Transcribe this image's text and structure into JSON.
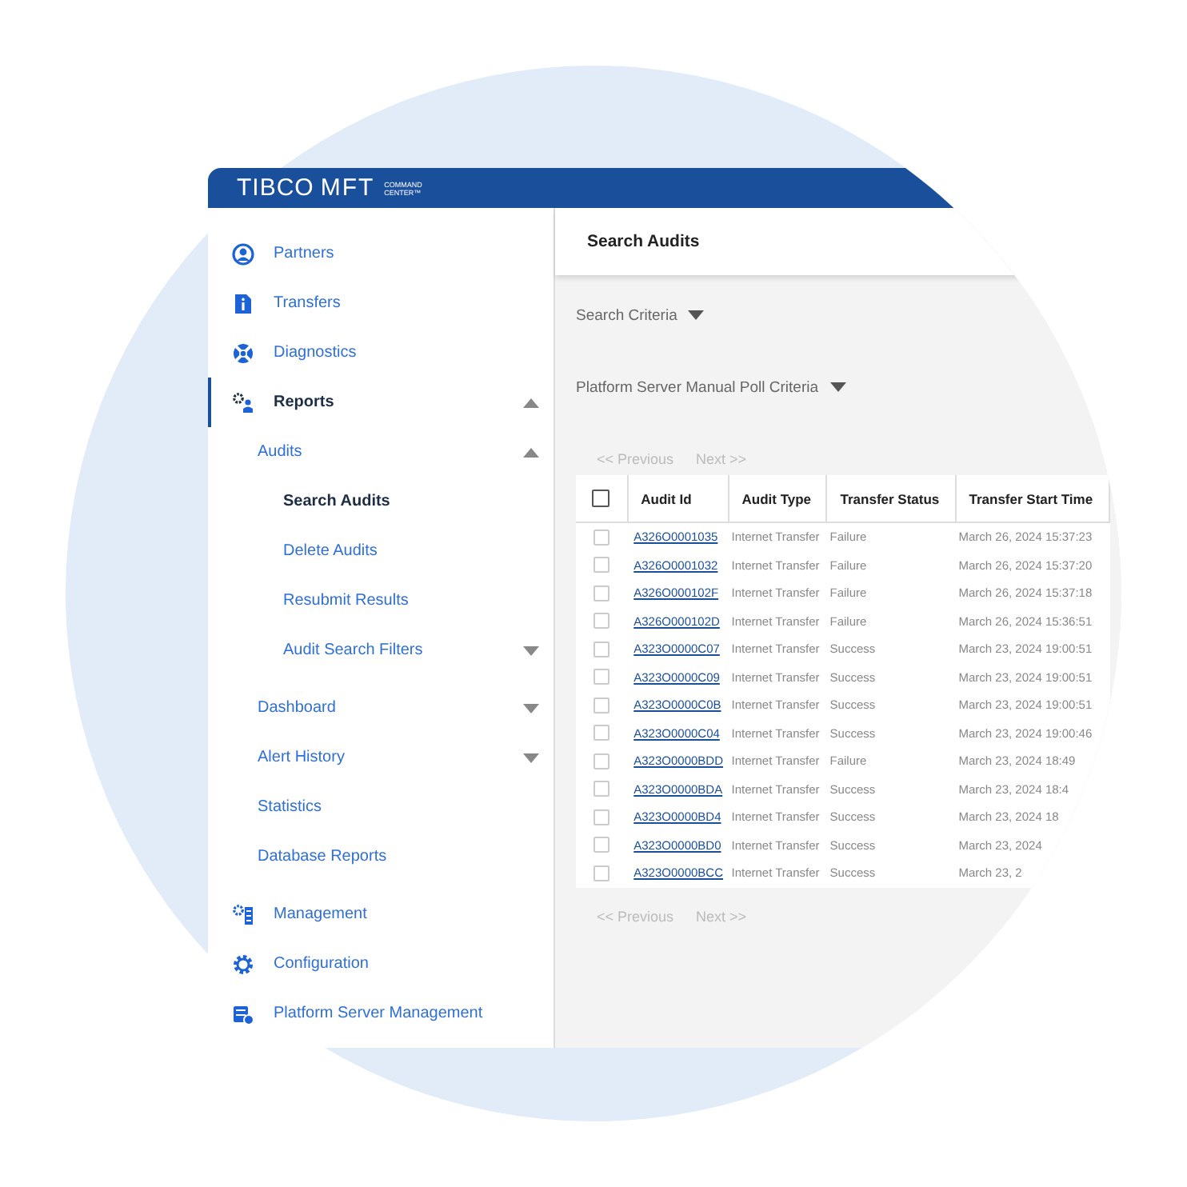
{
  "logo": {
    "brand": "TIBCO",
    "product": "MFT",
    "tagline_1": "COMMAND",
    "tagline_2": "CENTER™"
  },
  "sidebar": {
    "items": [
      {
        "label": "Partners",
        "selected": false
      },
      {
        "label": "Transfers",
        "selected": false
      },
      {
        "label": "Diagnostics",
        "selected": false
      },
      {
        "label": "Reports",
        "selected": true,
        "expanded": true,
        "children": [
          {
            "label": "Audits",
            "selected": false,
            "expanded": true,
            "children": [
              {
                "label": "Search Audits",
                "selected": true
              },
              {
                "label": "Delete Audits",
                "selected": false
              },
              {
                "label": "Resubmit Results",
                "selected": false
              },
              {
                "label": "Audit Search Filters",
                "selected": false,
                "expanded": false
              }
            ]
          },
          {
            "label": "Dashboard",
            "selected": false,
            "expanded": false
          },
          {
            "label": "Alert History",
            "selected": false,
            "expanded": false
          },
          {
            "label": "Statistics",
            "selected": false
          },
          {
            "label": "Database Reports",
            "selected": false
          }
        ]
      },
      {
        "label": "Management",
        "selected": false
      },
      {
        "label": "Configuration",
        "selected": false
      },
      {
        "label": "Platform Server Management",
        "selected": false
      }
    ]
  },
  "page": {
    "title": "Search Audits",
    "sections": [
      {
        "label": "Search Criteria",
        "expanded": false
      },
      {
        "label": "Platform Server Manual Poll Criteria",
        "expanded": false
      }
    ],
    "pager_top": {
      "previous": "<< Previous",
      "next": "Next >>"
    },
    "table": {
      "columns": [
        "Audit Id",
        "Audit Type",
        "Transfer Status",
        "Transfer Start Time"
      ],
      "all_checked": false,
      "rows": [
        {
          "checked": false,
          "id": "A326O0001035",
          "type": "Internet Transfer",
          "status": "Failure",
          "start": "March 26, 2024 15:37:23"
        },
        {
          "checked": false,
          "id": "A326O0001032",
          "type": "Internet Transfer",
          "status": "Failure",
          "start": "March 26, 2024 15:37:20"
        },
        {
          "checked": false,
          "id": "A326O000102F",
          "type": "Internet Transfer",
          "status": "Failure",
          "start": "March 26, 2024 15:37:18"
        },
        {
          "checked": false,
          "id": "A326O000102D",
          "type": "Internet Transfer",
          "status": "Failure",
          "start": "March 26, 2024 15:36:51"
        },
        {
          "checked": false,
          "id": "A323O0000C07",
          "type": "Internet Transfer",
          "status": "Success",
          "start": "March 23, 2024 19:00:51"
        },
        {
          "checked": false,
          "id": "A323O0000C09",
          "type": "Internet Transfer",
          "status": "Success",
          "start": "March 23, 2024 19:00:51"
        },
        {
          "checked": false,
          "id": "A323O0000C0B",
          "type": "Internet Transfer",
          "status": "Success",
          "start": "March 23, 2024 19:00:51"
        },
        {
          "checked": false,
          "id": "A323O0000C04",
          "type": "Internet Transfer",
          "status": "Success",
          "start": "March 23, 2024 19:00:46"
        },
        {
          "checked": false,
          "id": "A323O0000BDD",
          "type": "Internet Transfer",
          "status": "Failure",
          "start": "March 23, 2024 18:49"
        },
        {
          "checked": false,
          "id": "A323O0000BDA",
          "type": "Internet Transfer",
          "status": "Success",
          "start": "March 23, 2024 18:4"
        },
        {
          "checked": false,
          "id": "A323O0000BD4",
          "type": "Internet Transfer",
          "status": "Success",
          "start": "March 23, 2024 18"
        },
        {
          "checked": false,
          "id": "A323O0000BD0",
          "type": "Internet Transfer",
          "status": "Success",
          "start": "March 23, 2024"
        },
        {
          "checked": false,
          "id": "A323O0000BCC",
          "type": "Internet Transfer",
          "status": "Success",
          "start": "March 23, 2"
        }
      ]
    },
    "pager_bottom": {
      "previous": "<< Previous",
      "next": "Next >>"
    }
  }
}
